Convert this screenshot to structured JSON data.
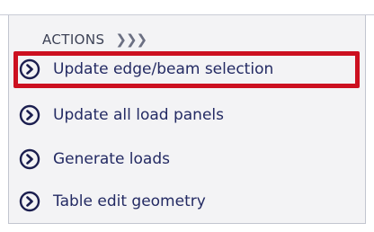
{
  "actions_panel": {
    "header_label": "ACTIONS",
    "header_chevron": "❯❯❯",
    "items": [
      {
        "label": "Update edge/beam selection",
        "icon": "chevron-right-circle-icon",
        "highlighted": true
      },
      {
        "label": "Update all load panels",
        "icon": "chevron-right-circle-icon",
        "highlighted": false
      },
      {
        "label": "Generate loads",
        "icon": "chevron-right-circle-icon",
        "highlighted": false
      },
      {
        "label": "Table edit geometry",
        "icon": "chevron-right-circle-icon",
        "highlighted": false
      }
    ]
  },
  "colors": {
    "text": "#232a63",
    "icon": "#1b1e4f",
    "highlight": "#cc1020",
    "panel_bg": "#f3f3f5"
  }
}
